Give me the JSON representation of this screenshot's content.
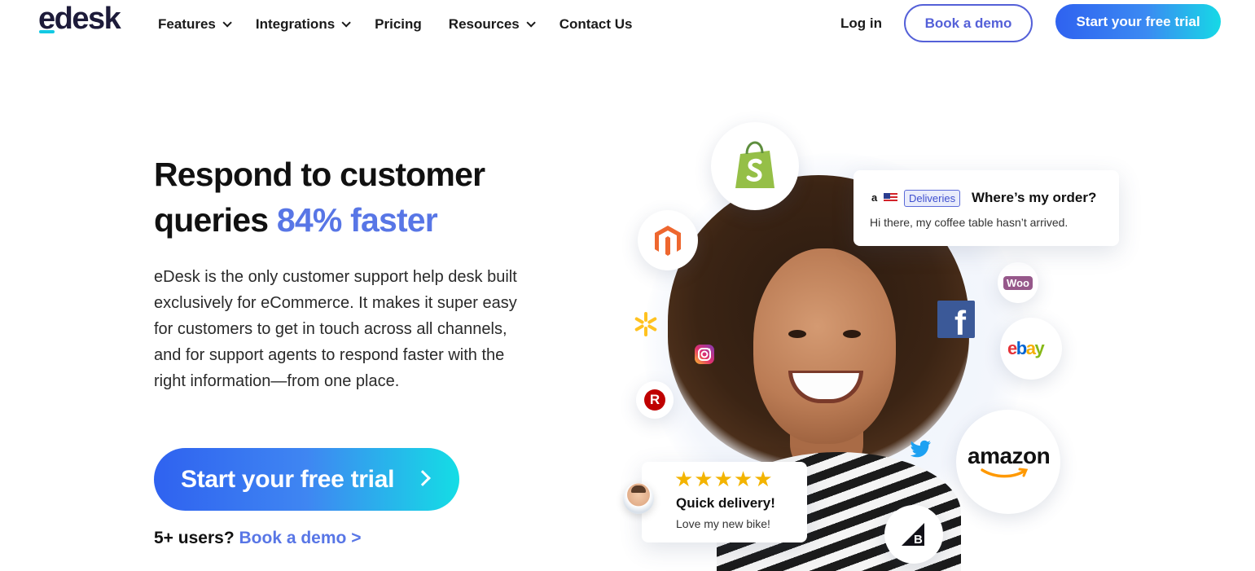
{
  "header": {
    "logo": "edesk",
    "nav": [
      {
        "label": "Features",
        "has_dropdown": true
      },
      {
        "label": "Integrations",
        "has_dropdown": true
      },
      {
        "label": "Pricing",
        "has_dropdown": false
      },
      {
        "label": "Resources",
        "has_dropdown": true
      },
      {
        "label": "Contact Us",
        "has_dropdown": false
      }
    ],
    "login": "Log in",
    "book_demo": "Book a demo",
    "start_trial": "Start your free trial"
  },
  "hero": {
    "title_line1": "Respond to customer",
    "title_line2_prefix": "queries ",
    "title_accent": "84% faster",
    "description": "eDesk is the only customer support help desk built exclusively for eCommerce. It makes it super easy for customers to get in touch across all channels, and for support agents to respond faster with the right information—from one place.",
    "cta": "Start your free trial",
    "users_prefix": "5+ users?",
    "users_link": "Book a demo >"
  },
  "illustration": {
    "order_card": {
      "source_mark": "a",
      "tag": "Deliveries",
      "question": "Where’s my order?",
      "message": "Hi there, my coffee table hasn’t arrived."
    },
    "review_card": {
      "stars": "★★★★★",
      "rating": 5,
      "title": "Quick delivery!",
      "text": "Love my new bike!"
    },
    "channel_logos": {
      "amazon": "amazon",
      "ebay": "ebay",
      "woo": "Woo",
      "facebook": "f",
      "rakuten": "R",
      "bigcommerce": "B"
    },
    "icons": [
      "shopify-icon",
      "magento-icon",
      "walmart-icon",
      "instagram-icon",
      "rakuten-icon",
      "facebook-icon",
      "woocommerce-icon",
      "ebay-icon",
      "twitter-icon",
      "amazon-icon",
      "bigcommerce-icon"
    ]
  },
  "colors": {
    "accent": "#5876e6",
    "gradient_start": "#2f62f0",
    "gradient_end": "#14dde5",
    "logo_underline": "#12c9e3"
  }
}
